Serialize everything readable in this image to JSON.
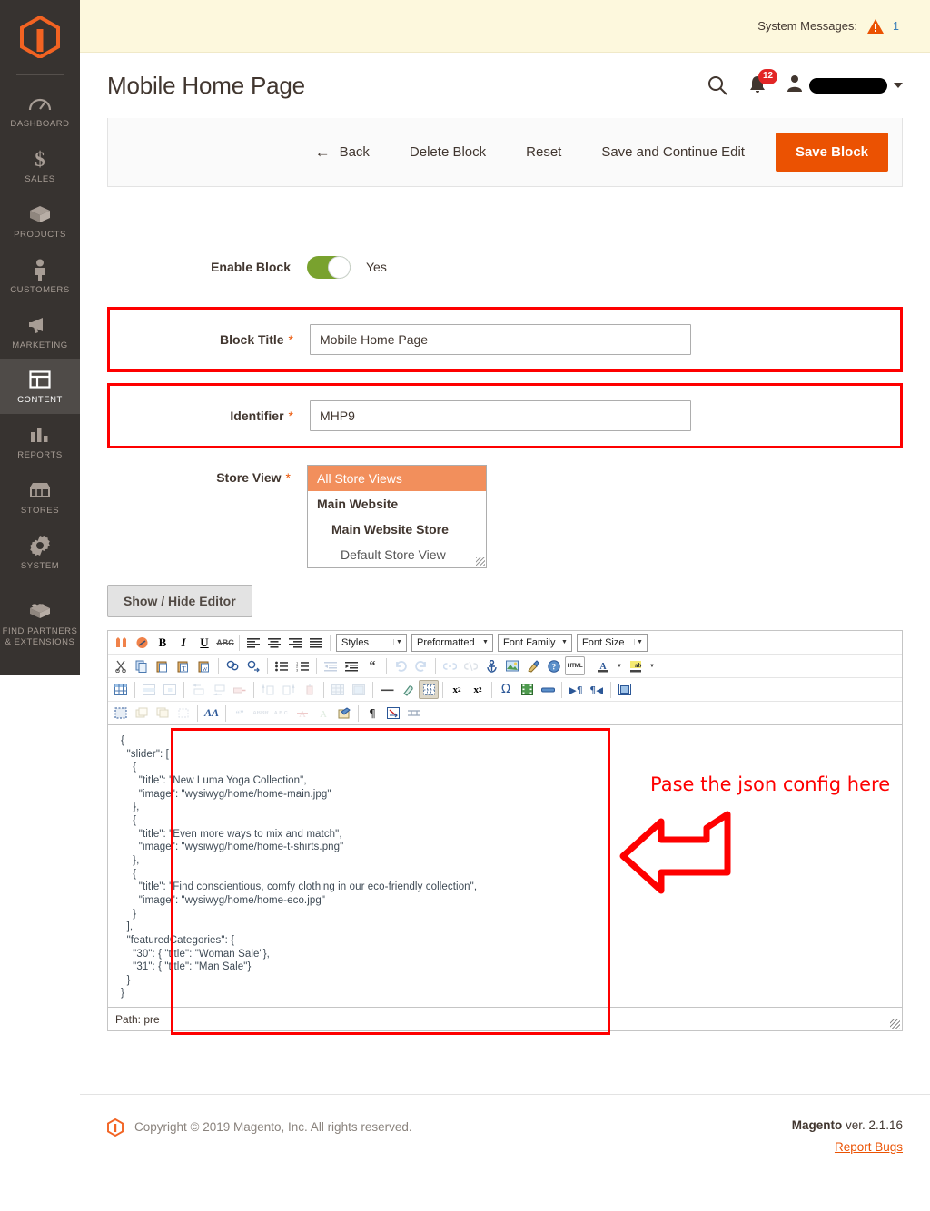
{
  "sidebar": {
    "logo_name": "magento-logo",
    "items": [
      {
        "label": "DASHBOARD",
        "icon": "dashboard-icon",
        "active": false
      },
      {
        "label": "SALES",
        "icon": "dollar-icon",
        "active": false
      },
      {
        "label": "PRODUCTS",
        "icon": "box-icon",
        "active": false
      },
      {
        "label": "CUSTOMERS",
        "icon": "person-icon",
        "active": false
      },
      {
        "label": "MARKETING",
        "icon": "megaphone-icon",
        "active": false
      },
      {
        "label": "CONTENT",
        "icon": "layout-icon",
        "active": true
      },
      {
        "label": "REPORTS",
        "icon": "bar-chart-icon",
        "active": false
      },
      {
        "label": "STORES",
        "icon": "storefront-icon",
        "active": false
      },
      {
        "label": "SYSTEM",
        "icon": "gear-icon",
        "active": false
      },
      {
        "label": "FIND PARTNERS & EXTENSIONS",
        "icon": "puzzle-brick-icon",
        "active": false
      }
    ]
  },
  "system_messages": {
    "label": "System Messages:",
    "count": "1",
    "icon": "warning-triangle-icon"
  },
  "header": {
    "title": "Mobile Home Page",
    "search_icon": "search-icon",
    "bell_icon": "notification-bell-icon",
    "notification_count": "12",
    "user_icon": "user-avatar-icon",
    "username": "",
    "caret_icon": "chevron-down-icon"
  },
  "toolbar": {
    "back_label": "Back",
    "back_icon": "arrow-left-icon",
    "delete_label": "Delete Block",
    "reset_label": "Reset",
    "save_continue_label": "Save and Continue Edit",
    "save_label": "Save Block"
  },
  "form": {
    "enable_block": {
      "label": "Enable Block",
      "value": "Yes",
      "state": "on"
    },
    "block_title": {
      "label": "Block Title",
      "required": "*",
      "value": "Mobile Home Page",
      "placeholder": ""
    },
    "identifier": {
      "label": "Identifier",
      "required": "*",
      "value": "MHP9",
      "placeholder": ""
    },
    "store_view": {
      "label": "Store View",
      "required": "*",
      "options": [
        {
          "label": "All Store Views",
          "level": 0,
          "selected": true
        },
        {
          "label": "Main Website",
          "level": 1,
          "selected": false
        },
        {
          "label": "Main Website Store",
          "level": 2,
          "selected": false
        },
        {
          "label": "Default Store View",
          "level": 3,
          "selected": false
        }
      ]
    }
  },
  "editor": {
    "show_hide_label": "Show / Hide Editor",
    "selects": [
      {
        "name": "styles-select",
        "value": "Styles"
      },
      {
        "name": "format-select",
        "value": "Preformatted"
      },
      {
        "name": "font-family-select",
        "value": "Font Family"
      },
      {
        "name": "font-size-select",
        "value": "Font Size"
      }
    ],
    "row1_icons": [
      "magento-widget-icon",
      "magento-variable-icon",
      "bold-icon",
      "italic-icon",
      "underline-icon",
      "strikethrough-icon",
      "align-left-icon",
      "align-center-icon",
      "align-right-icon",
      "align-justify-icon"
    ],
    "row2_icons": [
      "cut-icon",
      "copy-icon",
      "paste-icon",
      "paste-text-icon",
      "paste-word-icon",
      "find-icon",
      "find-replace-icon",
      "bullet-list-icon",
      "numbered-list-icon",
      "outdent-icon",
      "indent-icon",
      "blockquote-icon",
      "undo-icon",
      "redo-icon",
      "insert-link-icon",
      "unlink-icon",
      "anchor-icon",
      "insert-image-icon",
      "cleanup-icon",
      "help-icon",
      "html-source-icon",
      "text-color-icon",
      "background-color-icon"
    ],
    "row3_icons": [
      "insert-edit-table-icon",
      "table-row-properties-icon",
      "table-cell-properties-icon",
      "insert-row-before-icon",
      "insert-row-after-icon",
      "delete-row-icon",
      "insert-column-before-icon",
      "insert-column-after-icon",
      "delete-column-icon",
      "split-cells-icon",
      "merge-cells-icon",
      "horizontal-rule-icon",
      "remove-format-icon",
      "toggle-guidelines-icon",
      "subscript-icon",
      "superscript-icon",
      "special-character-icon",
      "insert-media-icon",
      "insert-page-break-icon",
      "ltr-icon",
      "rtl-icon",
      "fullscreen-icon"
    ],
    "row4_icons": [
      "select-all-icon",
      "insert-layer-icon",
      "move-layer-icon",
      "insert-div-icon",
      "style-props-icon",
      "citation-icon",
      "abbreviation-icon",
      "acronym-icon",
      "delete-text-icon",
      "insert-text-icon",
      "attributes-icon",
      "show-blocks-icon",
      "nonbreaking-icon",
      "page-break-icon"
    ],
    "content": "{\n  \"slider\": [\n    {\n      \"title\": \"New Luma Yoga Collection\",\n      \"image\": \"wysiwyg/home/home-main.jpg\"\n    },\n    {\n      \"title\": \"Even more ways to mix and match\",\n      \"image\": \"wysiwyg/home/home-t-shirts.png\"\n    },\n    {\n      \"title\": \"Find conscientious, comfy clothing in our eco-friendly collection\",\n      \"image\": \"wysiwyg/home/home-eco.jpg\"\n    }\n  ],\n  \"featuredCategories\": {\n    \"30\": { \"title\": \"Woman Sale\"},\n    \"31\": { \"title\": \"Man Sale\"}\n  }\n}",
    "path_label": "Path: pre"
  },
  "annotation": {
    "text": "Pase the json config here",
    "color": "#fe0000",
    "arrow_icon": "curved-arrow-left-icon"
  },
  "footer": {
    "copyright": "Copyright © 2019 Magento, Inc. All rights reserved.",
    "brand": "Magento",
    "version": " ver. 2.1.16",
    "report_bugs": "Report Bugs",
    "logo_icon": "magento-logo-icon"
  },
  "colors": {
    "accent": "#eb5202",
    "sidebar_bg": "#373330",
    "annotation_red": "#fe0000",
    "toggle_green": "#79a22e",
    "sysmsg_bg": "#fdf8dd",
    "badge_red": "#e22626",
    "select_highlight": "#f28f5c"
  }
}
